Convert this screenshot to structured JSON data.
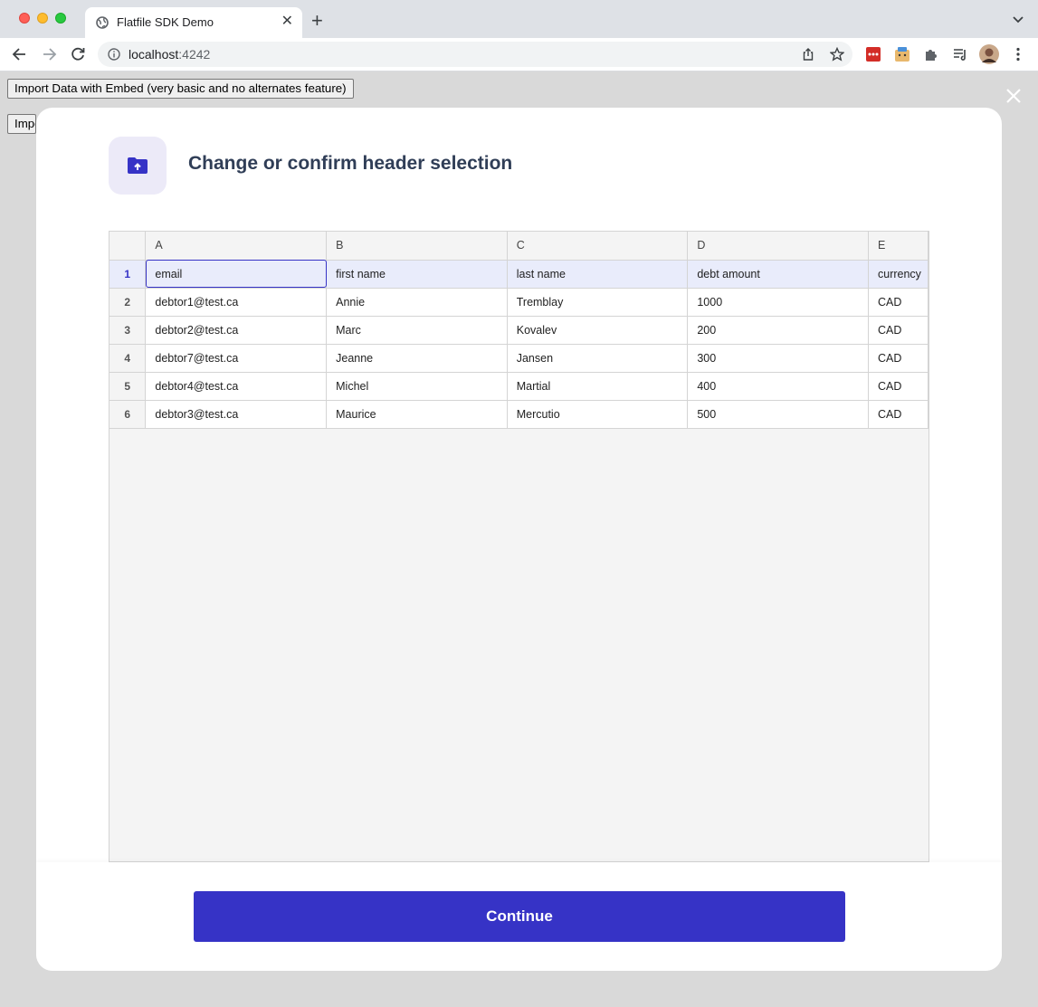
{
  "browser": {
    "tab_title": "Flatfile SDK Demo",
    "url_host": "localhost",
    "url_port": ":4242",
    "colors": {
      "tab_bar": "#dee1e6",
      "toolbar": "#ffffff"
    }
  },
  "page": {
    "buttons": [
      {
        "label": "Import Data with Embed (very basic and no alternates feature)"
      },
      {
        "label": "Impo"
      }
    ]
  },
  "modal": {
    "title": "Change or confirm header selection",
    "icon": "folder-upload-icon",
    "continue_label": "Continue",
    "accent_color": "#3633c6",
    "grid": {
      "columns": [
        "A",
        "B",
        "C",
        "D",
        "E"
      ],
      "selected_header_row": 1,
      "rows": [
        {
          "index": "1",
          "cells": [
            "email",
            "first name",
            "last name",
            "debt amount",
            "currency"
          ]
        },
        {
          "index": "2",
          "cells": [
            "debtor1@test.ca",
            "Annie",
            "Tremblay",
            "1000",
            "CAD"
          ]
        },
        {
          "index": "3",
          "cells": [
            "debtor2@test.ca",
            "Marc",
            "Kovalev",
            "200",
            "CAD"
          ]
        },
        {
          "index": "4",
          "cells": [
            "debtor7@test.ca",
            "Jeanne",
            "Jansen",
            "300",
            "CAD"
          ]
        },
        {
          "index": "5",
          "cells": [
            "debtor4@test.ca",
            "Michel",
            "Martial",
            "400",
            "CAD"
          ]
        },
        {
          "index": "6",
          "cells": [
            "debtor3@test.ca",
            "Maurice",
            "Mercutio",
            "500",
            "CAD"
          ]
        }
      ]
    }
  }
}
